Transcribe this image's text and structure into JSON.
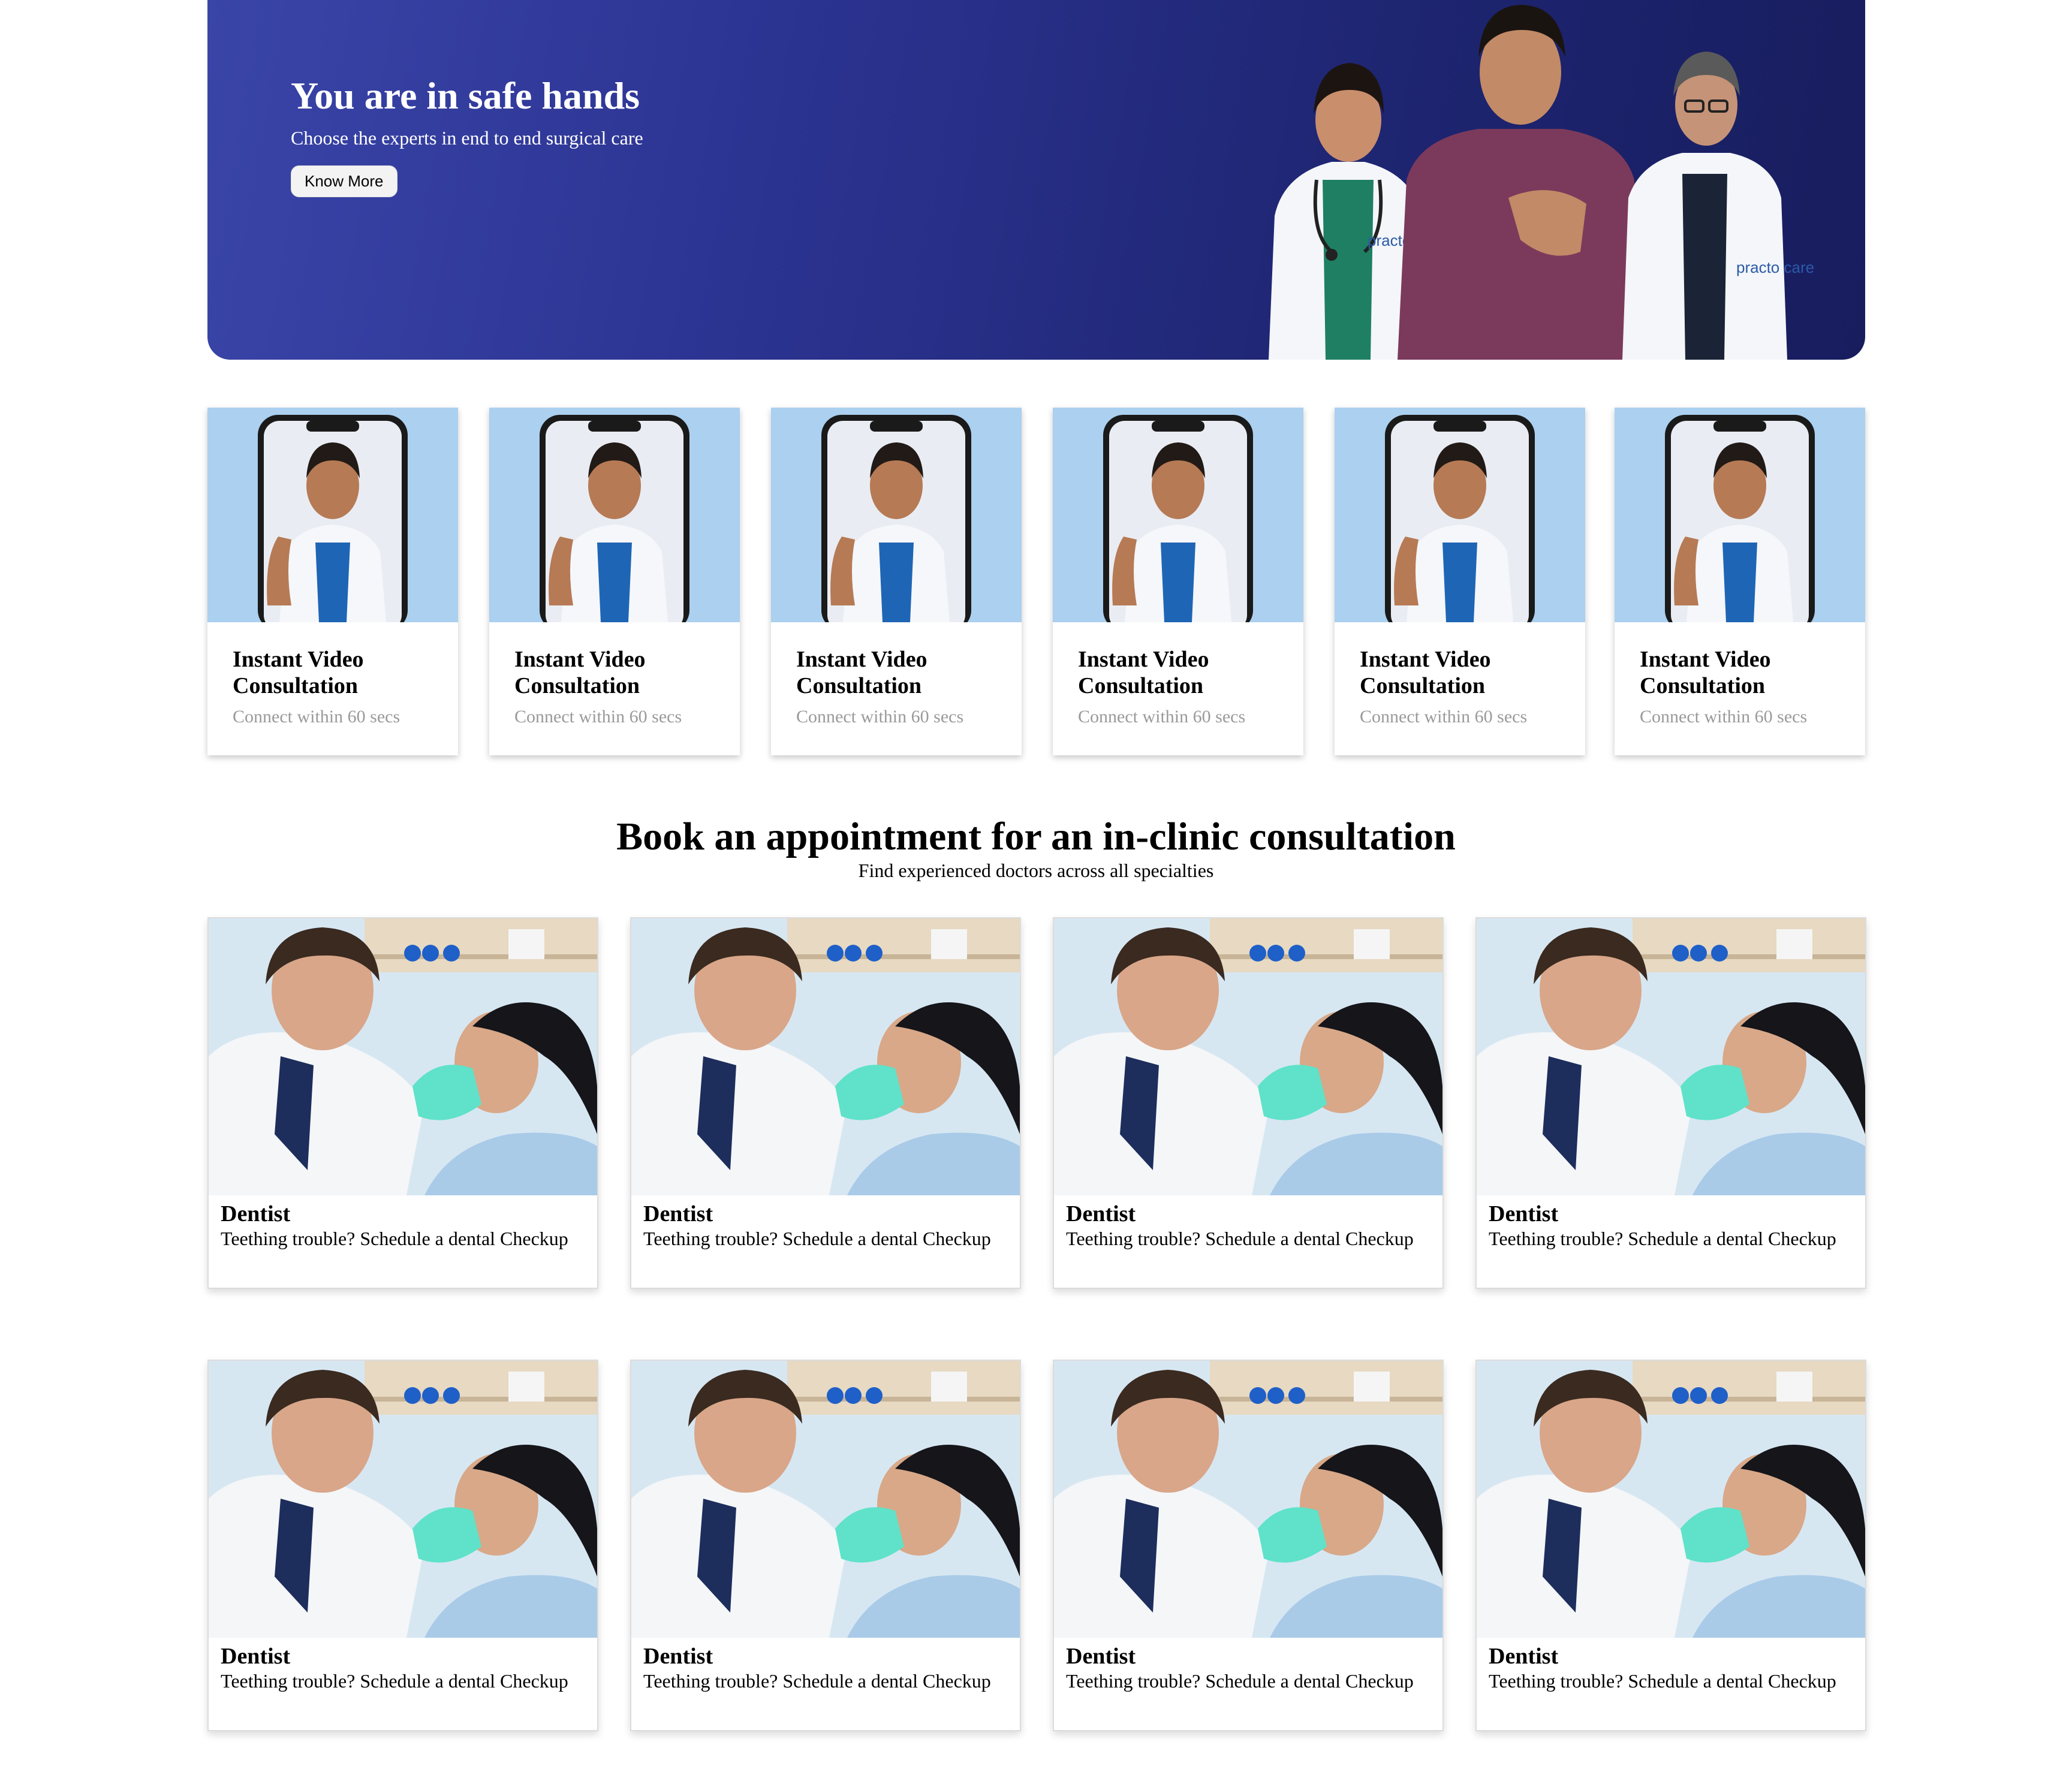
{
  "hero": {
    "title": "You are in safe hands",
    "subtitle": "Choose the experts in end to end surgical care",
    "button": "Know More",
    "badge_text_1": "practo care",
    "badge_text_2": "practo care",
    "colors": {
      "gradient_start": "#3a45a8",
      "gradient_end": "#181d5e"
    }
  },
  "video_cards": [
    {
      "title": "Instant Video Consultation",
      "subtitle": "Connect within 60 secs"
    },
    {
      "title": "Instant Video Consultation",
      "subtitle": "Connect within 60 secs"
    },
    {
      "title": "Instant Video Consultation",
      "subtitle": "Connect within 60 secs"
    },
    {
      "title": "Instant Video Consultation",
      "subtitle": "Connect within 60 secs"
    },
    {
      "title": "Instant Video Consultation",
      "subtitle": "Connect within 60 secs"
    },
    {
      "title": "Instant Video Consultation",
      "subtitle": "Connect within 60 secs"
    }
  ],
  "section": {
    "title": "Book an appointment for an in-clinic consultation",
    "subtitle": "Find experienced doctors across all specialties"
  },
  "specialties": [
    {
      "title": "Dentist",
      "subtitle": "Teething trouble? Schedule a dental Checkup"
    },
    {
      "title": "Dentist",
      "subtitle": "Teething trouble? Schedule a dental Checkup"
    },
    {
      "title": "Dentist",
      "subtitle": "Teething trouble? Schedule a dental Checkup"
    },
    {
      "title": "Dentist",
      "subtitle": "Teething trouble? Schedule a dental Checkup"
    },
    {
      "title": "Dentist",
      "subtitle": "Teething trouble? Schedule a dental Checkup"
    },
    {
      "title": "Dentist",
      "subtitle": "Teething trouble? Schedule a dental Checkup"
    },
    {
      "title": "Dentist",
      "subtitle": "Teething trouble? Schedule a dental Checkup"
    },
    {
      "title": "Dentist",
      "subtitle": "Teething trouble? Schedule a dental Checkup"
    }
  ]
}
